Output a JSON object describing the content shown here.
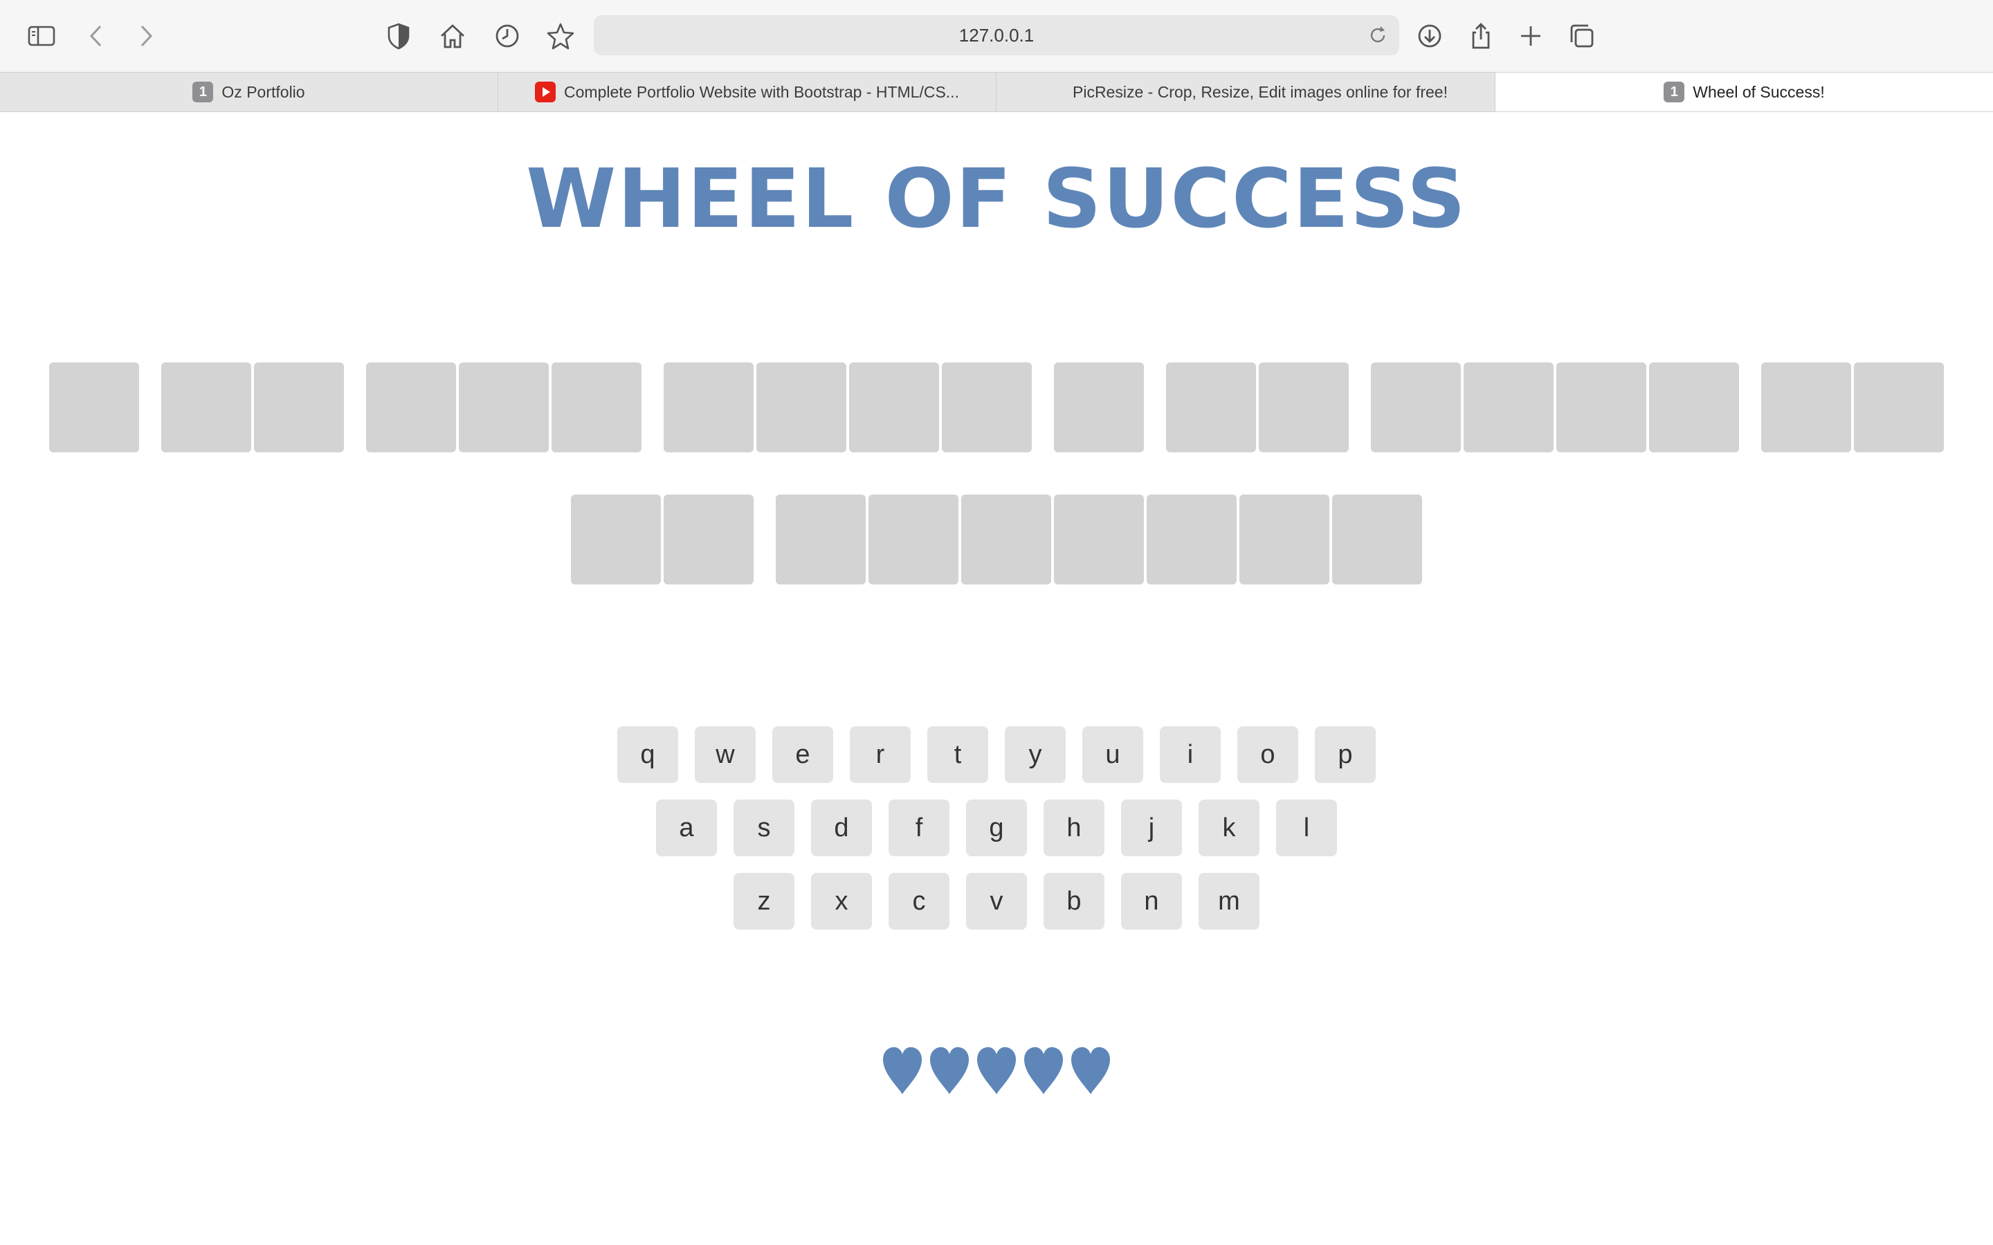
{
  "browser": {
    "url": "127.0.0.1",
    "tabs": [
      {
        "label": "Oz Portfolio",
        "favicon": "1",
        "active": false
      },
      {
        "label": "Complete Portfolio Website with Bootstrap - HTML/CS...",
        "favicon": "youtube-icon",
        "active": false
      },
      {
        "label": "PicResize - Crop, Resize, Edit images online for free!",
        "favicon": "picresize-icon",
        "active": false
      },
      {
        "label": "Wheel of Success!",
        "favicon": "1",
        "active": true
      }
    ]
  },
  "game": {
    "title": "WHEEL OF SUCCESS",
    "phrase_rows": [
      [
        1,
        2,
        3,
        4,
        1,
        2,
        4,
        2
      ],
      [
        2,
        7
      ]
    ],
    "keyboard": {
      "row1": [
        "q",
        "w",
        "e",
        "r",
        "t",
        "y",
        "u",
        "i",
        "o",
        "p"
      ],
      "row2": [
        "a",
        "s",
        "d",
        "f",
        "g",
        "h",
        "j",
        "k",
        "l"
      ],
      "row3": [
        "z",
        "x",
        "c",
        "v",
        "b",
        "n",
        "m"
      ]
    },
    "lives": 5,
    "colors": {
      "accent": "#5f86b8",
      "tile": "#d3d3d3",
      "key": "#e4e4e4"
    }
  }
}
